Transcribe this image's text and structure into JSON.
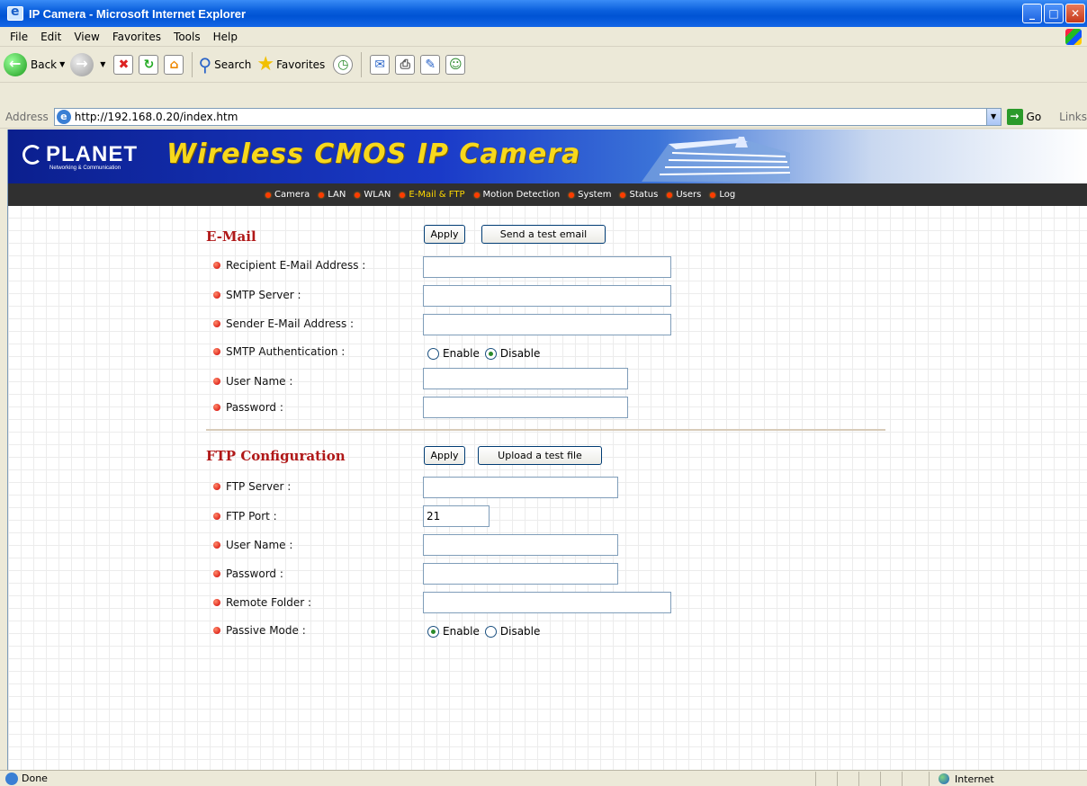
{
  "window": {
    "title": "IP Camera - Microsoft Internet Explorer",
    "btn_min": "_",
    "btn_max": "□",
    "btn_close": "✕"
  },
  "menu": [
    "File",
    "Edit",
    "View",
    "Favorites",
    "Tools",
    "Help"
  ],
  "toolbar": {
    "back": "Back",
    "search": "Search",
    "favorites": "Favorites"
  },
  "address": {
    "label": "Address",
    "url": "http://192.168.0.20/index.htm",
    "go": "Go",
    "links": "Links"
  },
  "banner": {
    "logo": "PLANET",
    "logo_sub": "Networking & Communication",
    "title": "Wireless CMOS IP Camera"
  },
  "nav": [
    {
      "label": "Camera",
      "active": false
    },
    {
      "label": "LAN",
      "active": false
    },
    {
      "label": "WLAN",
      "active": false
    },
    {
      "label": "E-Mail & FTP",
      "active": true
    },
    {
      "label": "Motion Detection",
      "active": false
    },
    {
      "label": "System",
      "active": false
    },
    {
      "label": "Status",
      "active": false
    },
    {
      "label": "Users",
      "active": false
    },
    {
      "label": "Log",
      "active": false
    }
  ],
  "email": {
    "title": "E-Mail",
    "apply": "Apply",
    "test": "Send a test email",
    "recipient_label": "Recipient E-Mail Address :",
    "recipient_value": "",
    "smtp_label": "SMTP Server :",
    "smtp_value": "",
    "sender_label": "Sender E-Mail Address :",
    "sender_value": "",
    "auth_label": "SMTP Authentication :",
    "auth_enable": "Enable",
    "auth_disable": "Disable",
    "auth_selected": "Disable",
    "user_label": "User Name :",
    "user_value": "",
    "pass_label": "Password :",
    "pass_value": ""
  },
  "ftp": {
    "title": "FTP Configuration",
    "apply": "Apply",
    "test": "Upload a test file",
    "server_label": "FTP Server :",
    "server_value": "",
    "port_label": "FTP Port :",
    "port_value": "21",
    "user_label": "User Name :",
    "user_value": "",
    "pass_label": "Password :",
    "pass_value": "",
    "folder_label": "Remote Folder :",
    "folder_value": "",
    "passive_label": "Passive Mode :",
    "passive_enable": "Enable",
    "passive_disable": "Disable",
    "passive_selected": "Enable"
  },
  "status": {
    "text": "Done",
    "zone": "Internet"
  }
}
